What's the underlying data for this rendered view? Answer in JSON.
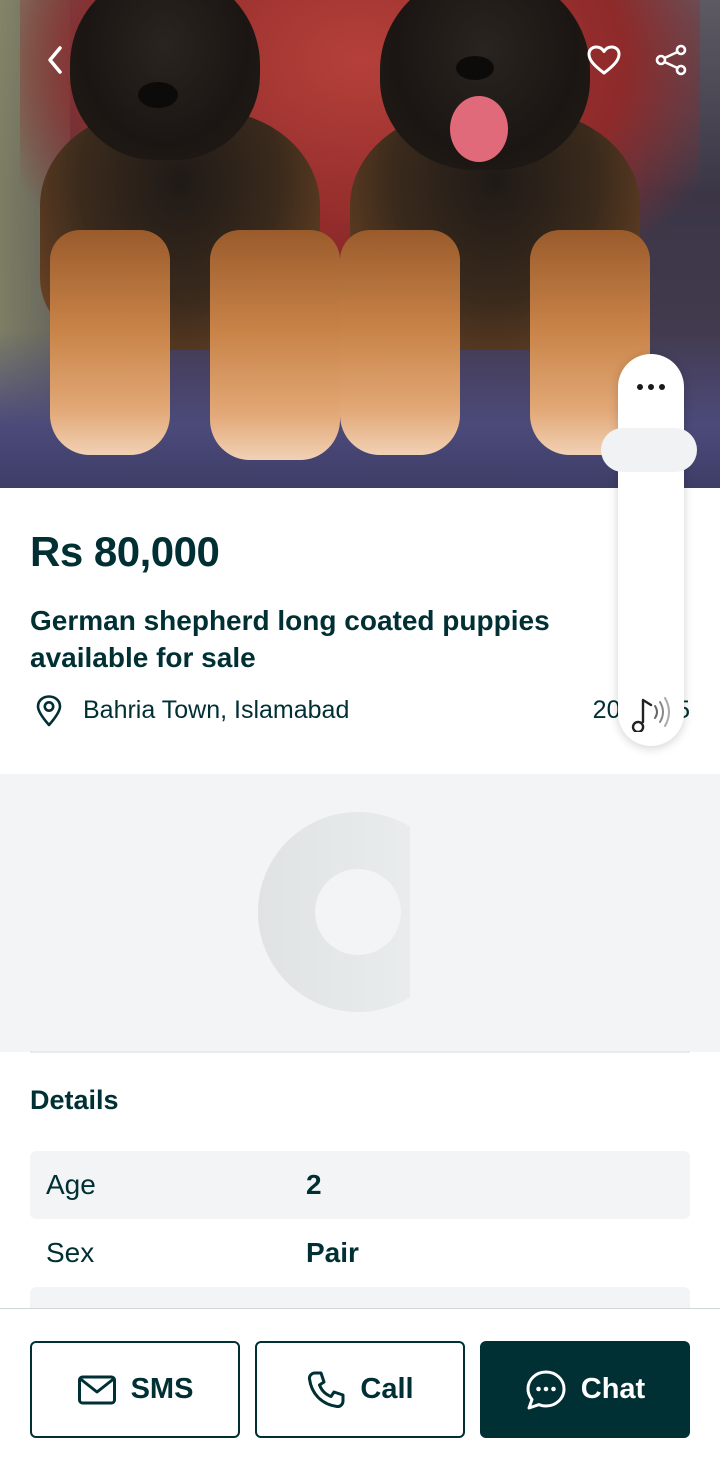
{
  "listing": {
    "price": "Rs 80,000",
    "title": "German shepherd long coated puppies available for sale",
    "location": "Bahria Town, Islamabad",
    "date": "20/04/25"
  },
  "hero": {
    "back_icon": "chevron-left-icon",
    "favorite_icon": "heart-outline-icon",
    "share_icon": "share-icon"
  },
  "float_widget": {
    "more_icon": "more-horizontal-icon",
    "music_icon": "music-sound-icon"
  },
  "details": {
    "heading": "Details",
    "rows": [
      {
        "label": "Age",
        "value": "2"
      },
      {
        "label": "Sex",
        "value": "Pair"
      }
    ]
  },
  "actions": {
    "sms_label": "SMS",
    "call_label": "Call",
    "chat_label": "Chat"
  },
  "colors": {
    "brand_dark": "#002f34",
    "surface_gray": "#f2f4f5"
  }
}
